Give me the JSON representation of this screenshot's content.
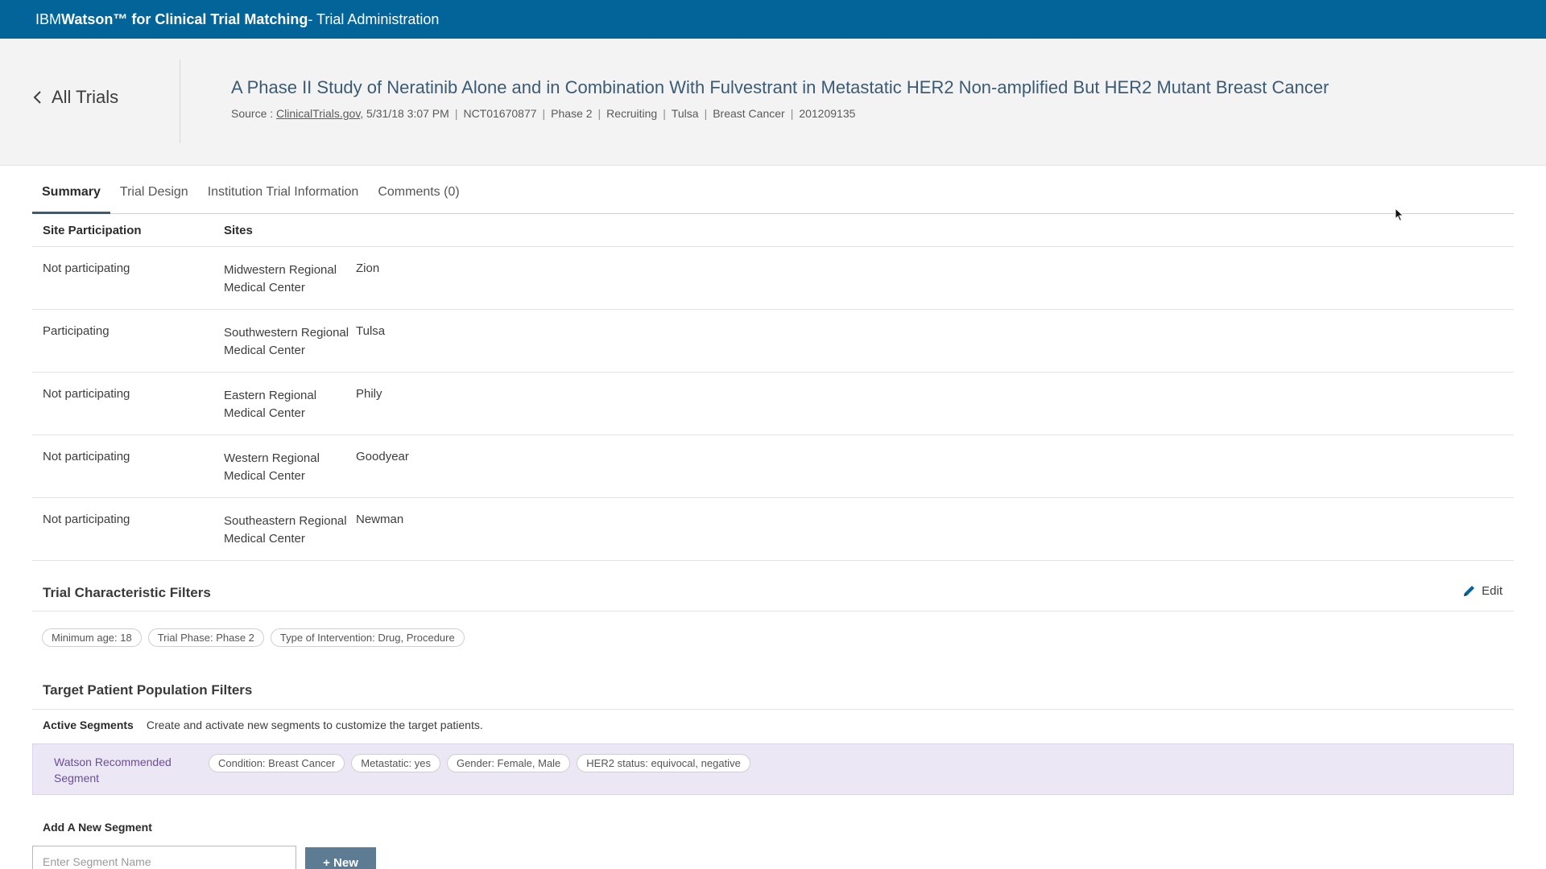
{
  "topbar": {
    "brand_prefix": "IBM ",
    "brand_bold": "Watson™ for Clinical Trial Matching",
    "brand_suffix": " - Trial Administration"
  },
  "header": {
    "back_label": "All Trials",
    "title": "A Phase II Study of Neratinib Alone and in Combination With Fulvestrant in Metastatic HER2 Non-amplified But HER2 Mutant Breast Cancer",
    "source_label": "Source : ",
    "source_link": "ClinicalTrials.gov",
    "meta": [
      ", 5/31/18 3:07 PM",
      "NCT01670877",
      "Phase 2",
      "Recruiting",
      "Tulsa",
      "Breast Cancer",
      "201209135"
    ]
  },
  "tabs": [
    "Summary",
    "Trial Design",
    "Institution Trial Information",
    "Comments (0)"
  ],
  "sites_table": {
    "headers": [
      "Site Participation",
      "Sites"
    ],
    "rows": [
      {
        "participation": "Not participating",
        "name": "Midwestern Regional Medical Center",
        "city": "Zion"
      },
      {
        "participation": "Participating",
        "name": "Southwestern Regional Medical Center",
        "city": "Tulsa"
      },
      {
        "participation": "Not participating",
        "name": "Eastern Regional Medical Center",
        "city": "Phily"
      },
      {
        "participation": "Not participating",
        "name": "Western Regional Medical Center",
        "city": "Goodyear"
      },
      {
        "participation": "Not participating",
        "name": "Southeastern Regional Medical Center",
        "city": "Newman"
      }
    ]
  },
  "trial_filters": {
    "title": "Trial Characteristic Filters",
    "edit_label": "Edit",
    "chips": [
      "Minimum age: 18",
      "Trial Phase: Phase 2",
      "Type of Intervention: Drug, Procedure"
    ]
  },
  "population": {
    "title": "Target Patient Population Filters",
    "active_label": "Active Segments",
    "active_desc": "Create and activate new segments to customize the target patients.",
    "segment_name": "Watson Recommended Segment",
    "segment_chips": [
      "Condition: Breast Cancer",
      "Metastatic: yes",
      "Gender: Female, Male",
      "HER2 status: equivocal, negative"
    ]
  },
  "add_segment": {
    "title": "Add A New Segment",
    "placeholder": "Enter Segment Name",
    "button_label": "+ New"
  },
  "colors": {
    "topbar": "#03649a",
    "segment_bg": "#ebe7f5",
    "segment_text": "#6c4c9c",
    "button": "#5d7b93"
  }
}
